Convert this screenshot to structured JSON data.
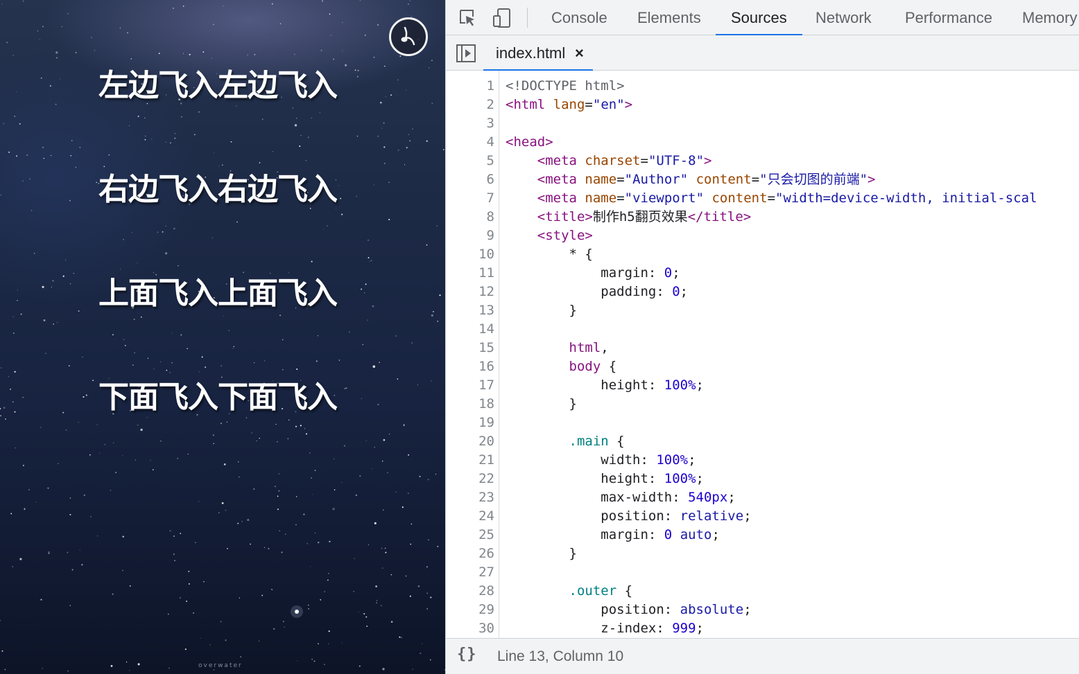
{
  "preview": {
    "fly_lines": [
      "左边飞入左边飞入",
      "右边飞入右边飞入",
      "上面飞入上面飞入",
      "下面飞入下面飞入"
    ],
    "watermark": "overwater",
    "music_icon": "music-note-icon"
  },
  "devtools": {
    "toolbar_icons": [
      "inspect-element-icon",
      "device-toolbar-icon"
    ],
    "tabs": [
      "Console",
      "Elements",
      "Sources",
      "Network",
      "Performance",
      "Memory"
    ],
    "active_tab": "Sources",
    "file_tab": {
      "name": "index.html",
      "close": "×"
    },
    "status": "Line 13, Column 10",
    "pretty_print": "{}",
    "line_numbers": [
      "1",
      "2",
      "3",
      "4",
      "5",
      "6",
      "7",
      "8",
      "9",
      "10",
      "11",
      "12",
      "13",
      "14",
      "15",
      "16",
      "17",
      "18",
      "19",
      "20",
      "21",
      "22",
      "23",
      "24",
      "25",
      "26",
      "27",
      "28",
      "29",
      "30"
    ],
    "code": [
      [
        [
          "doc",
          "<!DOCTYPE html>"
        ]
      ],
      [
        [
          "tag",
          "<html"
        ],
        [
          "punc",
          " "
        ],
        [
          "attr",
          "lang"
        ],
        [
          "punc",
          "="
        ],
        [
          "val",
          "\"en\""
        ],
        [
          "tag",
          ">"
        ]
      ],
      [],
      [
        [
          "tag",
          "<head>"
        ]
      ],
      [
        [
          "punc",
          "    "
        ],
        [
          "tag",
          "<meta"
        ],
        [
          "punc",
          " "
        ],
        [
          "attr",
          "charset"
        ],
        [
          "punc",
          "="
        ],
        [
          "val",
          "\"UTF-8\""
        ],
        [
          "tag",
          ">"
        ]
      ],
      [
        [
          "punc",
          "    "
        ],
        [
          "tag",
          "<meta"
        ],
        [
          "punc",
          " "
        ],
        [
          "attr",
          "name"
        ],
        [
          "punc",
          "="
        ],
        [
          "val",
          "\"Author\""
        ],
        [
          "punc",
          " "
        ],
        [
          "attr",
          "content"
        ],
        [
          "punc",
          "="
        ],
        [
          "val",
          "\"只会切图的前端\""
        ],
        [
          "tag",
          ">"
        ]
      ],
      [
        [
          "punc",
          "    "
        ],
        [
          "tag",
          "<meta"
        ],
        [
          "punc",
          " "
        ],
        [
          "attr",
          "name"
        ],
        [
          "punc",
          "="
        ],
        [
          "val",
          "\"viewport\""
        ],
        [
          "punc",
          " "
        ],
        [
          "attr",
          "content"
        ],
        [
          "punc",
          "="
        ],
        [
          "val",
          "\"width=device-width, initial-scal"
        ]
      ],
      [
        [
          "punc",
          "    "
        ],
        [
          "tag",
          "<title>"
        ],
        [
          "punc",
          "制作h5翻页效果"
        ],
        [
          "tag",
          "</title>"
        ]
      ],
      [
        [
          "punc",
          "    "
        ],
        [
          "tag",
          "<style>"
        ]
      ],
      [
        [
          "punc",
          "        * {"
        ]
      ],
      [
        [
          "punc",
          "            margin: "
        ],
        [
          "num",
          "0"
        ],
        [
          "punc",
          ";"
        ]
      ],
      [
        [
          "punc",
          "            padding: "
        ],
        [
          "num",
          "0"
        ],
        [
          "punc",
          ";"
        ]
      ],
      [
        [
          "punc",
          "        }"
        ]
      ],
      [],
      [
        [
          "punc",
          "        "
        ],
        [
          "tag",
          "html"
        ],
        [
          "punc",
          ","
        ]
      ],
      [
        [
          "punc",
          "        "
        ],
        [
          "tag",
          "body"
        ],
        [
          "punc",
          " {"
        ]
      ],
      [
        [
          "punc",
          "            height: "
        ],
        [
          "num",
          "100%"
        ],
        [
          "punc",
          ";"
        ]
      ],
      [
        [
          "punc",
          "        }"
        ]
      ],
      [],
      [
        [
          "punc",
          "        "
        ],
        [
          "sel",
          ".main"
        ],
        [
          "punc",
          " {"
        ]
      ],
      [
        [
          "punc",
          "            width: "
        ],
        [
          "num",
          "100%"
        ],
        [
          "punc",
          ";"
        ]
      ],
      [
        [
          "punc",
          "            height: "
        ],
        [
          "num",
          "100%"
        ],
        [
          "punc",
          ";"
        ]
      ],
      [
        [
          "punc",
          "            max-width: "
        ],
        [
          "num",
          "540px"
        ],
        [
          "punc",
          ";"
        ]
      ],
      [
        [
          "punc",
          "            position: "
        ],
        [
          "kw",
          "relative"
        ],
        [
          "punc",
          ";"
        ]
      ],
      [
        [
          "punc",
          "            margin: "
        ],
        [
          "num",
          "0"
        ],
        [
          "punc",
          " "
        ],
        [
          "kw",
          "auto"
        ],
        [
          "punc",
          ";"
        ]
      ],
      [
        [
          "punc",
          "        }"
        ]
      ],
      [],
      [
        [
          "punc",
          "        "
        ],
        [
          "sel",
          ".outer"
        ],
        [
          "punc",
          " {"
        ]
      ],
      [
        [
          "punc",
          "            position: "
        ],
        [
          "kw",
          "absolute"
        ],
        [
          "punc",
          ";"
        ]
      ],
      [
        [
          "punc",
          "            z-index: "
        ],
        [
          "num",
          "999"
        ],
        [
          "punc",
          ";"
        ]
      ]
    ]
  }
}
